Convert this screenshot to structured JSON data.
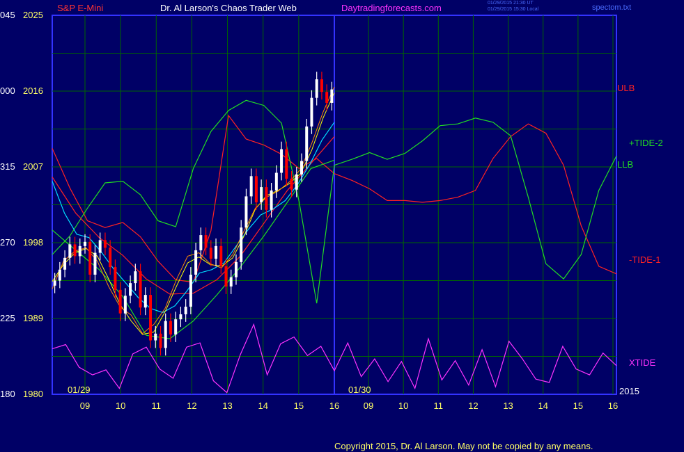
{
  "header": {
    "symbol": "S&P E-Mini",
    "title": "Dr. Al Larson's Chaos Trader Web",
    "site": "Daytradingforecasts.com",
    "stamp_line1": "01/29/2015 21:30 UT",
    "stamp_line2": "01/29/2015 15:30 Local",
    "file": "spectom.txt"
  },
  "copyright": "Copyright 2015, Dr. Al Larson. May not be copied by any means.",
  "colors": {
    "background": "#000066",
    "grid": "#006600",
    "frame": "#3333ff",
    "price_up": "#ffffff",
    "price_down": "#ff0000",
    "ulb": "#ff2222",
    "llb": "#22dd22",
    "tide_plus2": "#22dd22",
    "tide_minus1": "#ff2222",
    "xtide": "#ff33ff",
    "ma_fast": "#ff8800",
    "ma_mid": "#ffff00",
    "ma_slow": "#00ddff"
  },
  "chart_data": {
    "type": "line",
    "y_left_outer_labels": [
      "045",
      "000",
      "315",
      "270",
      "225",
      "180"
    ],
    "y_price_labels": [
      "2025",
      "2016",
      "2007",
      "1998",
      "1989",
      "1980"
    ],
    "ylim": [
      1980,
      2025
    ],
    "x_tick_labels": [
      "09",
      "10",
      "11",
      "12",
      "13",
      "14",
      "15",
      "16",
      "09",
      "10",
      "11",
      "12",
      "13",
      "14",
      "15",
      "16"
    ],
    "date_labels": [
      "01/29",
      "01/30"
    ],
    "year_label": "2015",
    "series_labels": [
      "ULB",
      "+TIDE-2",
      "LLB",
      "-TIDE-1",
      "XTIDE"
    ],
    "price_close": [
      1993.5,
      1994.8,
      1996.2,
      1997.8,
      1996.4,
      1997.6,
      1998.1,
      1994.2,
      1996.8,
      1998.3,
      1997.4,
      1995.1,
      1992.4,
      1989.6,
      1991.7,
      1993.2,
      1994.6,
      1990.3,
      1991.8,
      1986.4,
      1987.2,
      1985.5,
      1988.7,
      1987.1,
      1988.9,
      1989.5,
      1990.4,
      1994.2,
      1997.1,
      1998.9,
      1997.4,
      1996.1,
      1997.6,
      1995.2,
      1992.8,
      1993.9,
      1995.7,
      1999.8,
      2003.5,
      2005.9,
      2002.8,
      2004.6,
      2001.9,
      2004.2,
      2006.3,
      2009.1,
      2005.6,
      2004.3,
      2006.1,
      2007.7,
      2011.8,
      2015.2,
      2017.4,
      2015.9,
      2014.6,
      2016.2
    ],
    "ulb": [
      2009.2,
      2004.5,
      2000.6,
      1999.8,
      2000.4,
      1998.7,
      1995.8,
      1993.6,
      1993.3,
      1999.4,
      2013.1,
      2010.3,
      2009.6,
      2008.5,
      2006.8,
      2008.0,
      2006.2,
      2005.4,
      2004.4,
      2003.0,
      2003.0,
      2002.8,
      2003.0,
      2003.4,
      2004.2,
      2008.0,
      2010.6,
      2012.1,
      2011.0,
      2007.2,
      2000.0,
      1995.2,
      1994.3
    ],
    "llb": [
      1996.6,
      1998.8,
      2002.1,
      2005.1,
      2005.3,
      2003.7,
      2000.6,
      1999.9,
      2006.8,
      2011.2,
      2013.7,
      2014.9,
      2014.3,
      2012.2,
      2002.9,
      1990.8,
      2007.2,
      2007.9,
      2008.7,
      2007.9,
      2008.6,
      2010.1,
      2011.9,
      2012.1,
      2012.8,
      2012.3,
      2010.7,
      2003.4,
      1995.5,
      1993.7,
      1996.6,
      2004.2,
      2008.3
    ],
    "tide_plus2": [
      1999.5,
      1997.1,
      1994.8,
      1991.6,
      1987.0,
      1986.6,
      1988.7,
      1991.8,
      1995.1,
      1998.8,
      2002.8,
      2006.8,
      2007.8
    ],
    "tide_minus1": [
      2005.8,
      2001.5,
      1998.6,
      1996.5,
      1993.7,
      1991.9,
      1992.0,
      1993.6,
      1996.4,
      2000.3,
      2004.2,
      2007.4,
      2010.6
    ],
    "ma_fast": [
      1992.5,
      1995.8,
      1997.0,
      1997.4,
      1995.8,
      1992.8,
      1990.4,
      1989.4,
      1987.2,
      1988.3,
      1990.2,
      1993.6,
      1996.4,
      1996.8,
      1995.5,
      1995.0,
      1996.6,
      1999.4,
      2002.1,
      2003.4,
      2004.1,
      2005.2,
      2006.7,
      2009.8,
      2013.5,
      2016.5
    ],
    "ma_mid": [
      1993.4,
      1995.4,
      1996.8,
      1997.3,
      1996.4,
      1993.7,
      1990.7,
      1988.7,
      1987.1,
      1987.4,
      1989.8,
      1992.8,
      1995.6,
      1996.3,
      1995.4,
      1995.2,
      1996.2,
      1998.8,
      2002.0,
      2003.6,
      2004.2,
      2005.0,
      2006.2,
      2009.0,
      2012.8,
      2015.8
    ],
    "ma_slow": [
      2005.3,
      2001.5,
      1999.0,
      1998.6,
      1996.9,
      1994.9,
      1993.2,
      1991.5,
      1990.2,
      1989.7,
      1990.5,
      1992.3,
      1994.4,
      1994.8,
      1995.6,
      1997.6,
      1999.6,
      2001.3,
      2002.0,
      2003.0,
      2004.9,
      2007.3,
      2010.2,
      2012.3
    ],
    "xtide": [
      1985.4,
      1985.9,
      1983.2,
      1982.3,
      1982.9,
      1980.7,
      1984.8,
      1985.6,
      1983.0,
      1981.9,
      1985.6,
      1986.1,
      1981.6,
      1980.2,
      1984.7,
      1988.3,
      1982.3,
      1986.0,
      1986.8,
      1984.6,
      1985.7,
      1982.8,
      1986.1,
      1982.1,
      1984.2,
      1981.5,
      1983.9,
      1980.7,
      1986.6,
      1981.7,
      1984.0,
      1981.1,
      1985.3,
      1980.9,
      1986.3,
      1984.2,
      1981.8,
      1981.4,
      1985.7,
      1983.0,
      1982.3,
      1984.9,
      1983.4
    ]
  }
}
